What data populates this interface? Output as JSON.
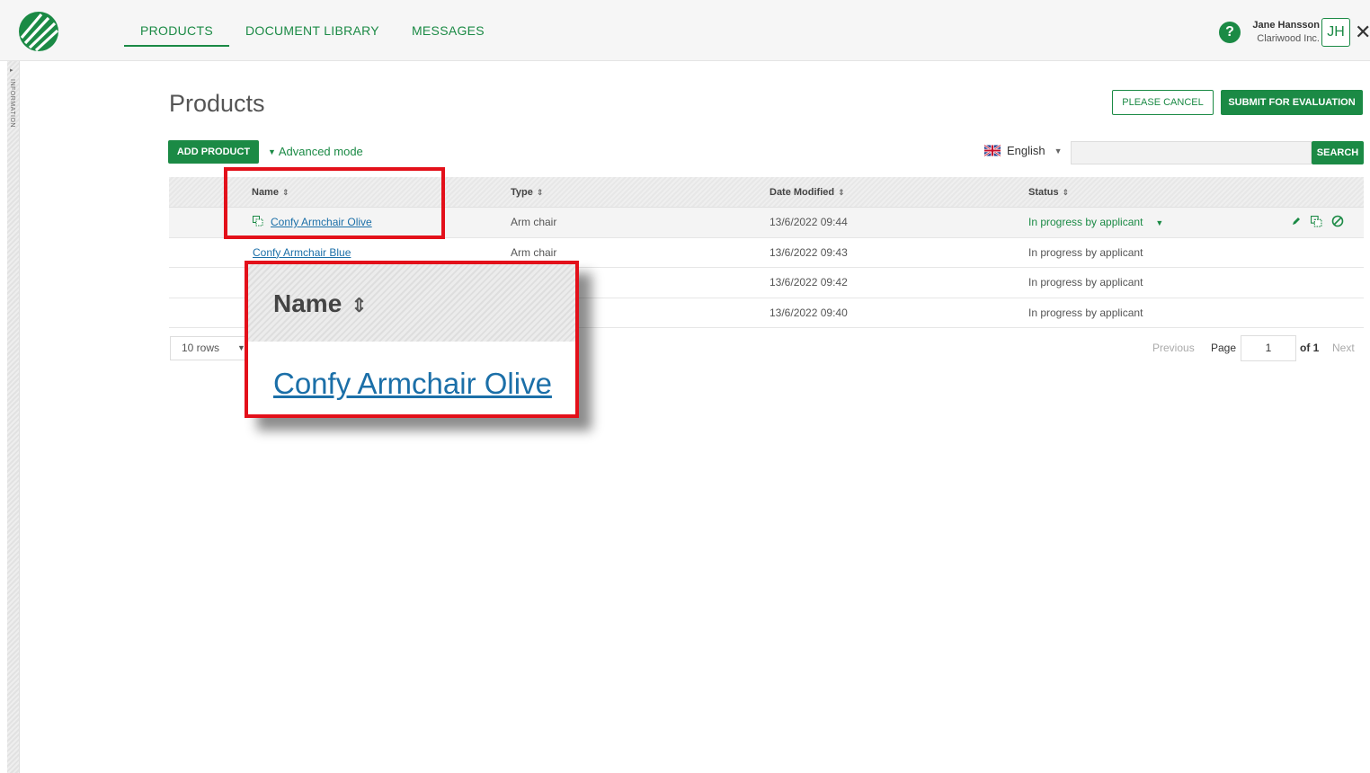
{
  "nav": {
    "items": [
      {
        "label": "PRODUCTS",
        "active": true
      },
      {
        "label": "DOCUMENT LIBRARY",
        "active": false
      },
      {
        "label": "MESSAGES",
        "active": false
      }
    ]
  },
  "user": {
    "name": "Jane Hansson",
    "organization": "Clariwood Inc.",
    "initials": "JH"
  },
  "help_icon_text": "?",
  "close_icon_text": "✕",
  "side_panel": {
    "label": "INFORMATION"
  },
  "page": {
    "title": "Products",
    "cancel_label": "PLEASE CANCEL",
    "submit_label": "SUBMIT FOR EVALUATION",
    "add_label": "ADD PRODUCT",
    "advanced_label": "Advanced mode"
  },
  "language": {
    "selected": "English"
  },
  "search": {
    "button_label": "SEARCH",
    "value": ""
  },
  "table": {
    "headers": {
      "name": "Name",
      "type": "Type",
      "date": "Date Modified",
      "status": "Status"
    },
    "rows": [
      {
        "name": "Confy Armchair Olive",
        "type": "Arm chair",
        "date": "13/6/2022 09:44",
        "status": "In progress by applicant"
      },
      {
        "name": "Confy Armchair Blue",
        "type": "Arm chair",
        "date": "13/6/2022 09:43",
        "status": "In progress by applicant"
      },
      {
        "name": "",
        "type": "",
        "date": "13/6/2022 09:42",
        "status": "In progress by applicant"
      },
      {
        "name": "",
        "type": "",
        "date": "13/6/2022 09:40",
        "status": "In progress by applicant"
      }
    ]
  },
  "pagination": {
    "rows_label": "10 rows",
    "previous": "Previous",
    "page_label": "Page",
    "page_value": "1",
    "of_label": "of 1",
    "next": "Next"
  },
  "zoom": {
    "header": "Name",
    "link": "Confy Armchair Olive"
  },
  "colors": {
    "brand_green": "#1b8a45",
    "link_blue": "#1b6fa8",
    "highlight_red": "#e3101a"
  }
}
